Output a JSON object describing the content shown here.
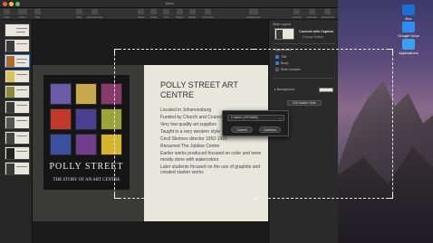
{
  "window": {
    "title": "Sean",
    "traffic_colors": [
      "#ee5f57",
      "#f5bd4f",
      "#5fc454"
    ]
  },
  "toolbar": {
    "items": [
      {
        "label": "View"
      },
      {
        "label": "Zoom"
      },
      {
        "label": "Play"
      },
      {
        "label": "Keynote Live"
      },
      {
        "label": "Table"
      },
      {
        "label": "Chart"
      },
      {
        "label": "Text"
      },
      {
        "label": "Shape"
      },
      {
        "label": "Media"
      },
      {
        "label": "Comment"
      },
      {
        "label": "Collaborate"
      },
      {
        "label": "Format"
      },
      {
        "label": "Animate"
      },
      {
        "label": "Document"
      }
    ]
  },
  "desktop_icons": [
    {
      "label": "Box",
      "color": "#1a6ed8"
    },
    {
      "label": "Google Drive",
      "color": "#2f8cf0"
    },
    {
      "label": "Applications",
      "color": "#3aa0f0"
    }
  ],
  "slide": {
    "title": "POLLY STREET ART CENTRE",
    "bullets": [
      "Located in Johannesburg",
      "Funded by Church and Council",
      "Very low quality art supplies",
      "Taught in a very western style",
      "Cecil Skotnes director 1952-1965",
      "Renamed The Jubilee Centre",
      "Earlier works produced focused on color and were mostly done with watercolors",
      "Later students focused on the use of graphite and created starker works"
    ],
    "book_title": "POLLY STREET",
    "book_subtitle": "THE STORY OF AN ART CENTRE",
    "tile_colors": [
      [
        "#6a5ca8",
        "#c7a84a",
        "#8a3a6a"
      ],
      [
        "#c0392b",
        "#4b3f92",
        "#9aa43a"
      ],
      [
        "#3a4fa0",
        "#6f3d8a",
        "#d6b52e"
      ]
    ]
  },
  "popup": {
    "select_value": "Custom (#97a685)",
    "cancel_label": "Cancel",
    "continue_label": "Continue"
  },
  "inspector": {
    "layout_label": "Slide Layout",
    "layout_name": "Content with Caption",
    "change_master": "Change Master",
    "appearance": "Appearance",
    "options": [
      "Title",
      "Body",
      "Slide Number"
    ],
    "background": "Background",
    "edit_master": "Edit Master Slide"
  }
}
